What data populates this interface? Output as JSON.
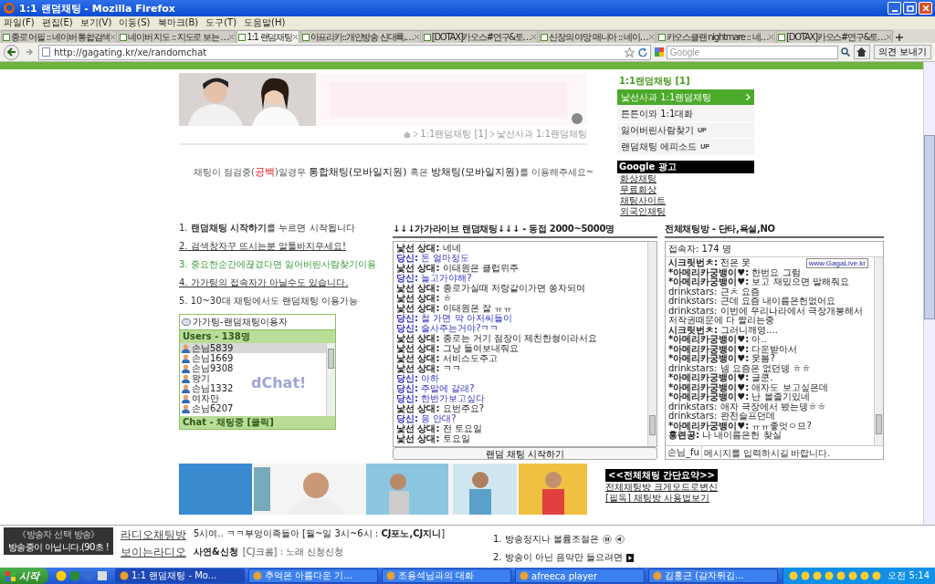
{
  "window": {
    "title": "1:1 랜덤채팅 - Mozilla Firefox"
  },
  "menu": [
    "파일(F)",
    "편집(E)",
    "보기(V)",
    "이동(S)",
    "북마크(B)",
    "도구(T)",
    "도움말(H)"
  ],
  "tabs": [
    {
      "label": "종로 어필 :: 네이버 통합검색",
      "selected": false
    },
    {
      "label": "네이버 지도 :: 지도로 보는 …",
      "selected": false
    },
    {
      "label": "1:1 랜덤채팅",
      "selected": true
    },
    {
      "label": "아프리카::개인방송 신대륙,…",
      "selected": false
    },
    {
      "label": "[DOTAX]카오스#연구&토…",
      "selected": false
    },
    {
      "label": "신장의 야망 매니아 :: 네이…",
      "selected": false
    },
    {
      "label": "카오스클랜 nightmare :: 네…",
      "selected": false
    },
    {
      "label": "[DOTAX]카오스#연구&토…",
      "selected": false
    }
  ],
  "address": {
    "url": "http://gagating.kr/xe/randomchat",
    "search_placeholder": "Google",
    "feedback": "의견 보내기"
  },
  "breadcrumb": [
    "1:1랜덤채팅 [1]",
    "낯선사과 1:1랜덤채팅"
  ],
  "side_menu": {
    "title": "1:1랜덤채팅 [1]",
    "items": [
      {
        "label": "낯선사과 1:1랜덤채팅",
        "selected": true
      },
      {
        "label": "튼튼이와 1:1대화",
        "selected": false
      },
      {
        "label": "잃어버린사람찾기",
        "selected": false,
        "badge": "UP"
      },
      {
        "label": "랜덤채팅 에피소드",
        "selected": false,
        "badge": "UP"
      }
    ]
  },
  "ads": {
    "title": "Google 광고",
    "links": [
      "화상채팅",
      "무료화상",
      "채팅사이트",
      "외국인채팅"
    ]
  },
  "notice": [
    {
      "kind": "small",
      "text": "채팅이 점검중("
    },
    {
      "kind": "accent",
      "text": "공백"
    },
    {
      "kind": "small",
      "text": ")일경우 "
    },
    {
      "kind": "big",
      "text": "통합채팅(모바일지원)"
    },
    {
      "kind": "small",
      "text": " 혹은 "
    },
    {
      "kind": "big",
      "text": "방채팅(모바일지원)"
    },
    {
      "kind": "small",
      "text": "를 이용해주세요~"
    }
  ],
  "instructions": [
    {
      "kind": "plain",
      "text": "1. **랜덤채팅 시작하기**를 누르면 시작됩니다"
    },
    {
      "kind": "link",
      "text": "2. 검색창자꾸 뜨시는분 알툴바지우세요!"
    },
    {
      "kind": "green",
      "text": "3. 중요한순간에끊겼다면 잃어버린사람찾기이용"
    },
    {
      "kind": "link",
      "text": "4. 가가팅의 접속자가 아닐수도 있습니다."
    },
    {
      "kind": "plain",
      "text": "5. 10~30대 채팅에서도 랜덤채팅 이용가능"
    }
  ],
  "user_list": {
    "title": "가가팅-랜덤채팅이용자",
    "count": "Users - 138명",
    "watermark": "dChat!",
    "footer": "Chat - 채팅중 [클릭]",
    "users": [
      {
        "name": "손님5839",
        "selected": true
      },
      {
        "name": "손님1669",
        "selected": false
      },
      {
        "name": "손님9308",
        "selected": false
      },
      {
        "name": "왕기",
        "selected": false
      },
      {
        "name": "손님1332",
        "selected": false
      },
      {
        "name": "여자만",
        "selected": false
      },
      {
        "name": "손님6207",
        "selected": false
      }
    ]
  },
  "random_chat": {
    "heading": "↓↓↓가가라이브 랜덤채팅↓↓↓ - 동접 2000~5000명",
    "button": "랜덤 채팅 시작하기",
    "messages": [
      {
        "kind": "stranger",
        "speaker": "낯선 상대:",
        "text": "네네"
      },
      {
        "kind": "you",
        "speaker": "당신:",
        "text": "돈 얼마정도"
      },
      {
        "kind": "stranger",
        "speaker": "낯선 상대:",
        "text": "이태원은 클럽위주"
      },
      {
        "kind": "you",
        "speaker": "당신:",
        "text": "놀고가야해?"
      },
      {
        "kind": "stranger",
        "speaker": "낯선 상대:",
        "text": "종로가실때 저랑같이가면 쏭자되여"
      },
      {
        "kind": "stranger",
        "speaker": "낯선 상대:",
        "text": "ㅎ"
      },
      {
        "kind": "stranger",
        "speaker": "낯선 상대:",
        "text": "이태원은 잘 ㅠㅠ"
      },
      {
        "kind": "you",
        "speaker": "당신:",
        "text": "철 가면 막 아저씨들이"
      },
      {
        "kind": "you",
        "speaker": "당신:",
        "text": "술사주는거야?ㅋㅋ"
      },
      {
        "kind": "stranger",
        "speaker": "낯선 상대:",
        "text": "종로는 거기 점장이 제친한형이라서요"
      },
      {
        "kind": "stranger",
        "speaker": "낯선 상대:",
        "text": "그냥 들여보내줘요"
      },
      {
        "kind": "stranger",
        "speaker": "낯선 상대:",
        "text": "서비스도주고"
      },
      {
        "kind": "stranger",
        "speaker": "낯선 상대:",
        "text": "ㅋㅋ"
      },
      {
        "kind": "you",
        "speaker": "당신:",
        "text": "아하"
      },
      {
        "kind": "you",
        "speaker": "당신:",
        "text": "주말에 갈래?"
      },
      {
        "kind": "you",
        "speaker": "당신:",
        "text": "한번가보고싶다"
      },
      {
        "kind": "stranger",
        "speaker": "낯선 상대:",
        "text": "요번주요?"
      },
      {
        "kind": "you",
        "speaker": "당신:",
        "text": "응 안대?"
      },
      {
        "kind": "stranger",
        "speaker": "낯선 상대:",
        "text": "전 토요일"
      },
      {
        "kind": "stranger",
        "speaker": "낯선 상대:",
        "text": "토요일"
      }
    ]
  },
  "group_chat": {
    "heading": "전체채팅방 - 단타,욕설,NO",
    "users": "접속자: 174 명",
    "tooltip": "www.GagaLive.kr",
    "nick": "손님_fu",
    "placeholder": "메시지를 입력하시길 바랍니다.",
    "messages": [
      {
        "kind": "nick",
        "speaker": "시크릿번ㅊ:",
        "text": "전은 못"
      },
      {
        "kind": "nick",
        "speaker": "*아메리카궁뱅이♥:",
        "text": "한번요 그럼"
      },
      {
        "kind": "nick",
        "speaker": "*아메리카궁뱅이♥:",
        "text": "보고 재밌으면 말해줘요"
      },
      {
        "kind": "id",
        "speaker": "drinkstars:",
        "text": "근ㅊ 요즘"
      },
      {
        "kind": "id",
        "speaker": "drinkstars:",
        "text": "근데 요즘 내이름은헌없어요"
      },
      {
        "kind": "id",
        "speaker": "drinkstars:",
        "text": "이번에 우리나라에서 극장개봉해서 저작권때문에 다 짤리는중"
      },
      {
        "kind": "nick",
        "speaker": "시크릿번ㅊ:",
        "text": "그러니깨영...."
      },
      {
        "kind": "nick",
        "speaker": "*아메리카궁뱅이♥:",
        "text": "아.."
      },
      {
        "kind": "nick",
        "speaker": "*아메리카궁뱅이♥:",
        "text": "다운받아서"
      },
      {
        "kind": "nick",
        "speaker": "*아메리카궁뱅이♥:",
        "text": "못봄?"
      },
      {
        "kind": "id",
        "speaker": "drinkstars:",
        "text": "넴 요즘은 없던뎅 ㅎㅎ"
      },
      {
        "kind": "nick",
        "speaker": "*아메리카궁뱅이♥:",
        "text": "글쿤."
      },
      {
        "kind": "nick",
        "speaker": "*아메리카궁뱅이♥:",
        "text": "애자도 보고싶은데"
      },
      {
        "kind": "nick",
        "speaker": "*아메리카궁뱅이♥:",
        "text": "난 볼줄기있네"
      },
      {
        "kind": "id",
        "speaker": "drinkstars:",
        "text": "애자 극장에서 봤는뎅ㅎㅎ"
      },
      {
        "kind": "id",
        "speaker": "drinkstars:",
        "text": "완전슬프던데"
      },
      {
        "kind": "nick",
        "speaker": "*아메리카궁뱅이♥:",
        "text": "ㅠㅠ좋엇ㅇ므?"
      },
      {
        "kind": "nick",
        "speaker": "홍련공:",
        "text": "나 내이름은헌 찾실"
      }
    ]
  },
  "summary": {
    "title": "<<전체채팅 간단요약>>",
    "links": [
      "전체채팅방 크게모드로변신",
      "[필독] 채팅방 사용법보기"
    ]
  },
  "radio": {
    "dj_title": "《방송자 선택 방송》",
    "dj_status": "방송중이 아닙니다.(90초 !",
    "names": [
      "라디오채팅방",
      "보이는라디오"
    ],
    "schedule": "5시여.. ㅋㅋ부엉이족들아 [월~일 3시~6시 : **CJ포노,CJ지니**]",
    "request_label": "사연&신청",
    "request": "[CJ크롬] : 노래 신청신청",
    "tips": [
      "1. 방송정지나 볼륨조절은",
      "2. 방송이 아닌 음악만 들으려면"
    ]
  },
  "taskbar": {
    "start": "시작",
    "tasks": [
      {
        "label": "1:1 랜덤채팅 - Mo...",
        "selected": true
      },
      {
        "label": "추억은 아름다운 기...",
        "selected": false
      },
      {
        "label": "조용석님과의 대화",
        "selected": false
      },
      {
        "label": "afreeca player",
        "selected": false
      },
      {
        "label": "김홍근 (감자튀김...",
        "selected": false
      }
    ],
    "clock": "오전 5:14"
  }
}
